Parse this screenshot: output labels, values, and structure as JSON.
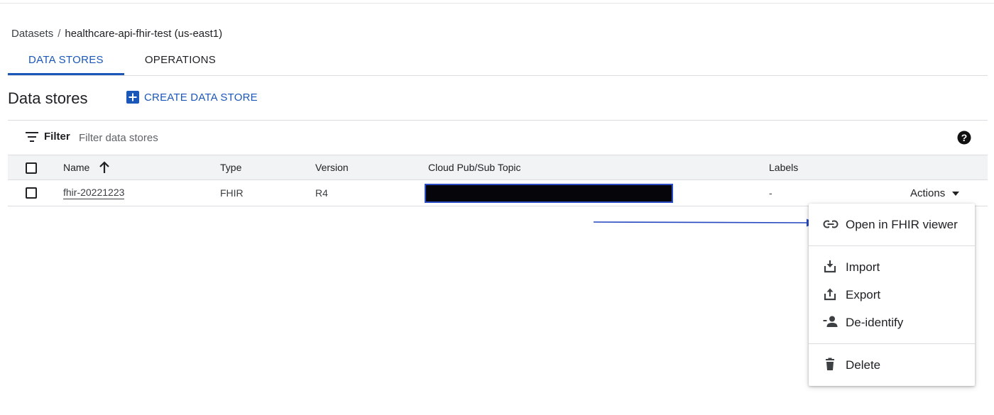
{
  "breadcrumb": {
    "parent": "Datasets",
    "separator": "/",
    "current": "healthcare-api-fhir-test (us-east1)"
  },
  "tabs": [
    {
      "label": "DATA STORES",
      "active": true
    },
    {
      "label": "OPERATIONS",
      "active": false
    }
  ],
  "section": {
    "title": "Data stores",
    "create_label": "CREATE DATA STORE"
  },
  "filter": {
    "label": "Filter",
    "placeholder": "Filter data stores"
  },
  "table": {
    "columns": [
      "Name",
      "Type",
      "Version",
      "Cloud Pub/Sub Topic",
      "Labels"
    ],
    "rows": [
      {
        "name": "fhir-20221223",
        "type": "FHIR",
        "version": "R4",
        "topic": "",
        "labels": "-",
        "actions_label": "Actions"
      }
    ]
  },
  "menu": {
    "items": [
      {
        "label": "Open in FHIR viewer",
        "icon": "link-icon"
      },
      {
        "label": "Import",
        "icon": "import-icon"
      },
      {
        "label": "Export",
        "icon": "export-icon"
      },
      {
        "label": "De-identify",
        "icon": "de-identify-icon"
      },
      {
        "label": "Delete",
        "icon": "trash-icon"
      }
    ]
  },
  "colors": {
    "accent": "#1a57b8",
    "annotation_arrow": "#2446c0",
    "redaction": "#05050a"
  }
}
